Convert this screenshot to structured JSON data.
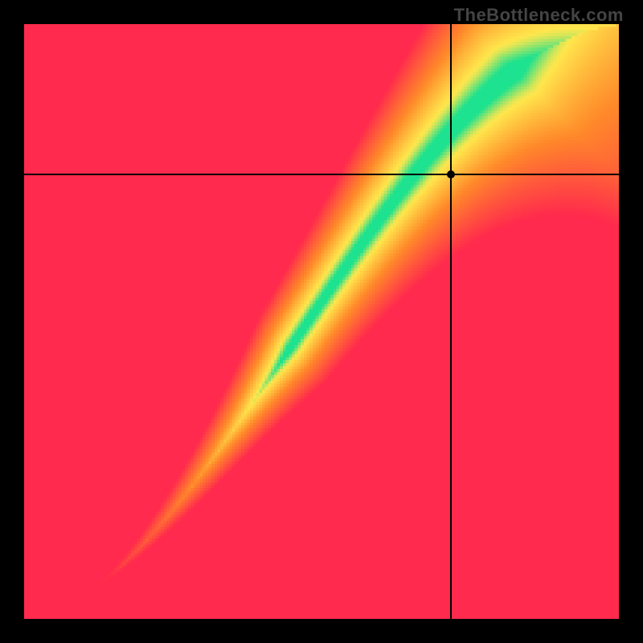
{
  "watermark": "TheBottleneck.com",
  "plot": {
    "grid_size": 200,
    "colors": {
      "red": "#ff2a4d",
      "orange": "#ff8a2a",
      "yellow": "#ffe74d",
      "green": "#1de28f"
    }
  },
  "marker": {
    "x_frac": 0.717,
    "y_frac": 0.253
  },
  "chart_data": {
    "type": "heatmap",
    "title": "",
    "xlabel": "",
    "ylabel": "",
    "xlim": [
      0,
      1
    ],
    "ylim": [
      0,
      1
    ],
    "color_scale": [
      {
        "value": 0.0,
        "color": "#ff2a4d",
        "meaning": "severe mismatch"
      },
      {
        "value": 0.4,
        "color": "#ff8a2a",
        "meaning": "mismatch"
      },
      {
        "value": 0.7,
        "color": "#ffe74d",
        "meaning": "near optimal"
      },
      {
        "value": 1.0,
        "color": "#1de28f",
        "meaning": "optimal"
      }
    ],
    "optimal_curve_samples": [
      {
        "x": 0.0,
        "y": 0.0
      },
      {
        "x": 0.1,
        "y": 0.06
      },
      {
        "x": 0.2,
        "y": 0.14
      },
      {
        "x": 0.3,
        "y": 0.25
      },
      {
        "x": 0.4,
        "y": 0.38
      },
      {
        "x": 0.5,
        "y": 0.52
      },
      {
        "x": 0.6,
        "y": 0.65
      },
      {
        "x": 0.7,
        "y": 0.79
      },
      {
        "x": 0.8,
        "y": 0.9
      },
      {
        "x": 0.9,
        "y": 0.97
      },
      {
        "x": 1.0,
        "y": 1.0
      }
    ],
    "marker_point": {
      "x": 0.717,
      "y": 0.747
    },
    "annotations": []
  }
}
